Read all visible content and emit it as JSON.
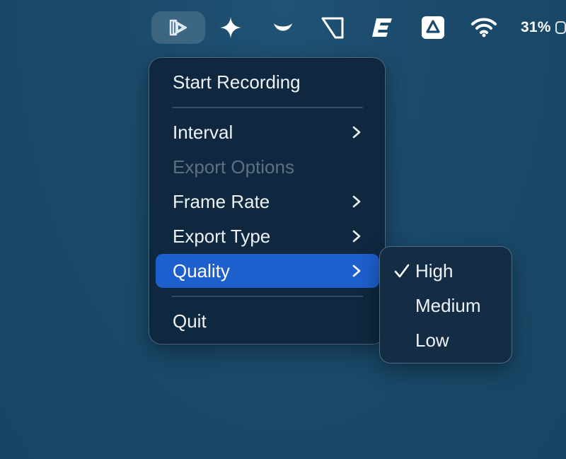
{
  "menubar": {
    "battery_text": "31%",
    "icons": [
      "app-play-icon",
      "sparkle-icon",
      "smile-icon",
      "shape-icon",
      "e-icon",
      "drive-icon",
      "wifi-icon",
      "battery-icon"
    ]
  },
  "menu": {
    "items": [
      {
        "label": "Start Recording"
      },
      {
        "label": "Interval",
        "has_submenu": true
      },
      {
        "label": "Export Options",
        "disabled": true
      },
      {
        "label": "Frame Rate",
        "has_submenu": true
      },
      {
        "label": "Export Type",
        "has_submenu": true
      },
      {
        "label": "Quality",
        "has_submenu": true,
        "selected": true
      },
      {
        "label": "Quit"
      }
    ],
    "selected_color": "#1d5fcc"
  },
  "submenu": {
    "items": [
      {
        "label": "High",
        "checked": true
      },
      {
        "label": "Medium"
      },
      {
        "label": "Low"
      }
    ]
  }
}
